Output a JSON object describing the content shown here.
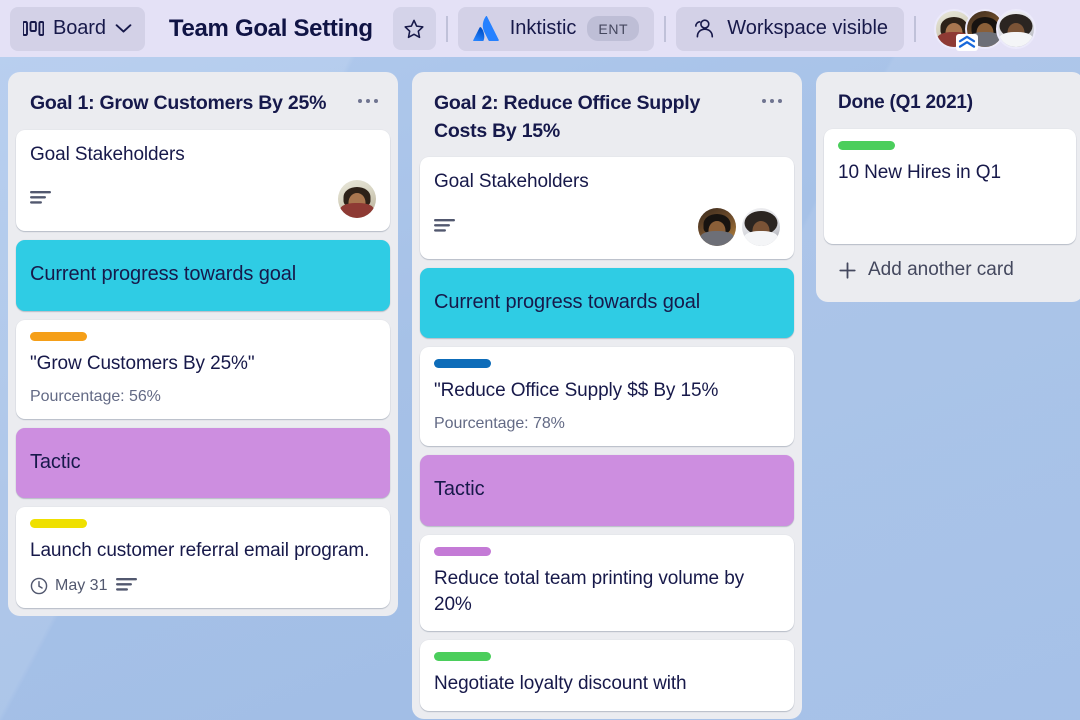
{
  "app": {
    "board_view_label": "Board",
    "board_title": "Team Goal Setting",
    "workspace_name": "Inktistic",
    "workspace_plan": "ENT",
    "visibility_label": "Workspace visible",
    "icons": {
      "board": "board-icon",
      "chevron_down": "chevron-down-icon",
      "star": "star-icon",
      "atlassian": "atlassian-logo-icon",
      "people": "people-icon",
      "list_menu": "ellipsis-icon",
      "description": "description-icon",
      "clock": "clock-icon",
      "plus": "plus-icon",
      "premium_badge": "premium-chevrons-icon"
    },
    "colors": {
      "top_bar": "#e4e1f6",
      "board_background": "#a9c5ea",
      "list_background": "#ebecf0",
      "card_background": "#ffffff",
      "text_primary": "#17194a",
      "text_secondary": "#636a85",
      "section_cyan": "#2fcce4",
      "section_purple": "#cd8ee0"
    },
    "members": [
      {
        "name": "member-1"
      },
      {
        "name": "member-2"
      },
      {
        "name": "member-3"
      }
    ]
  },
  "lists": [
    {
      "title": "Goal 1: Grow Customers By 25%",
      "cards": [
        {
          "kind": "member",
          "title": "Goal Stakeholders",
          "has_description": true,
          "avatars": 1
        },
        {
          "kind": "section",
          "color": "cyan",
          "title": "Current progress towards goal"
        },
        {
          "kind": "labeled",
          "label_color": "#f59f18",
          "title": "\"Grow Customers By 25%\"",
          "subtitle": "Pourcentage: 56%"
        },
        {
          "kind": "section",
          "color": "purple",
          "title": "Tactic"
        },
        {
          "kind": "labeled",
          "label_color": "#efe000",
          "title": "Launch customer referral email program.",
          "due_date": "May 31",
          "has_description": true
        }
      ]
    },
    {
      "title": "Goal 2: Reduce Office Supply Costs By 15%",
      "cards": [
        {
          "kind": "member",
          "title": "Goal Stakeholders",
          "has_description": true,
          "avatars": 2
        },
        {
          "kind": "section",
          "color": "cyan",
          "title": "Current progress towards goal"
        },
        {
          "kind": "labeled",
          "label_color": "#0d6cb9",
          "title": "\"Reduce Office Supply $$ By 15%",
          "subtitle": "Pourcentage: 78%"
        },
        {
          "kind": "section",
          "color": "purple",
          "title": "Tactic"
        },
        {
          "kind": "labeled",
          "label_color": "#c munged",
          "title": "Reduce total team printing volume by 20%"
        },
        {
          "kind": "labeled",
          "label_color": "#4cc košt",
          "title": "Negotiate loyalty discount with"
        }
      ]
    },
    {
      "title": "Done (Q1 2021)",
      "add_card_label": "Add another card",
      "cards": [
        {
          "kind": "labeled",
          "label_color": "#4bce5c",
          "title": "10 New Hires in Q1"
        }
      ]
    }
  ]
}
